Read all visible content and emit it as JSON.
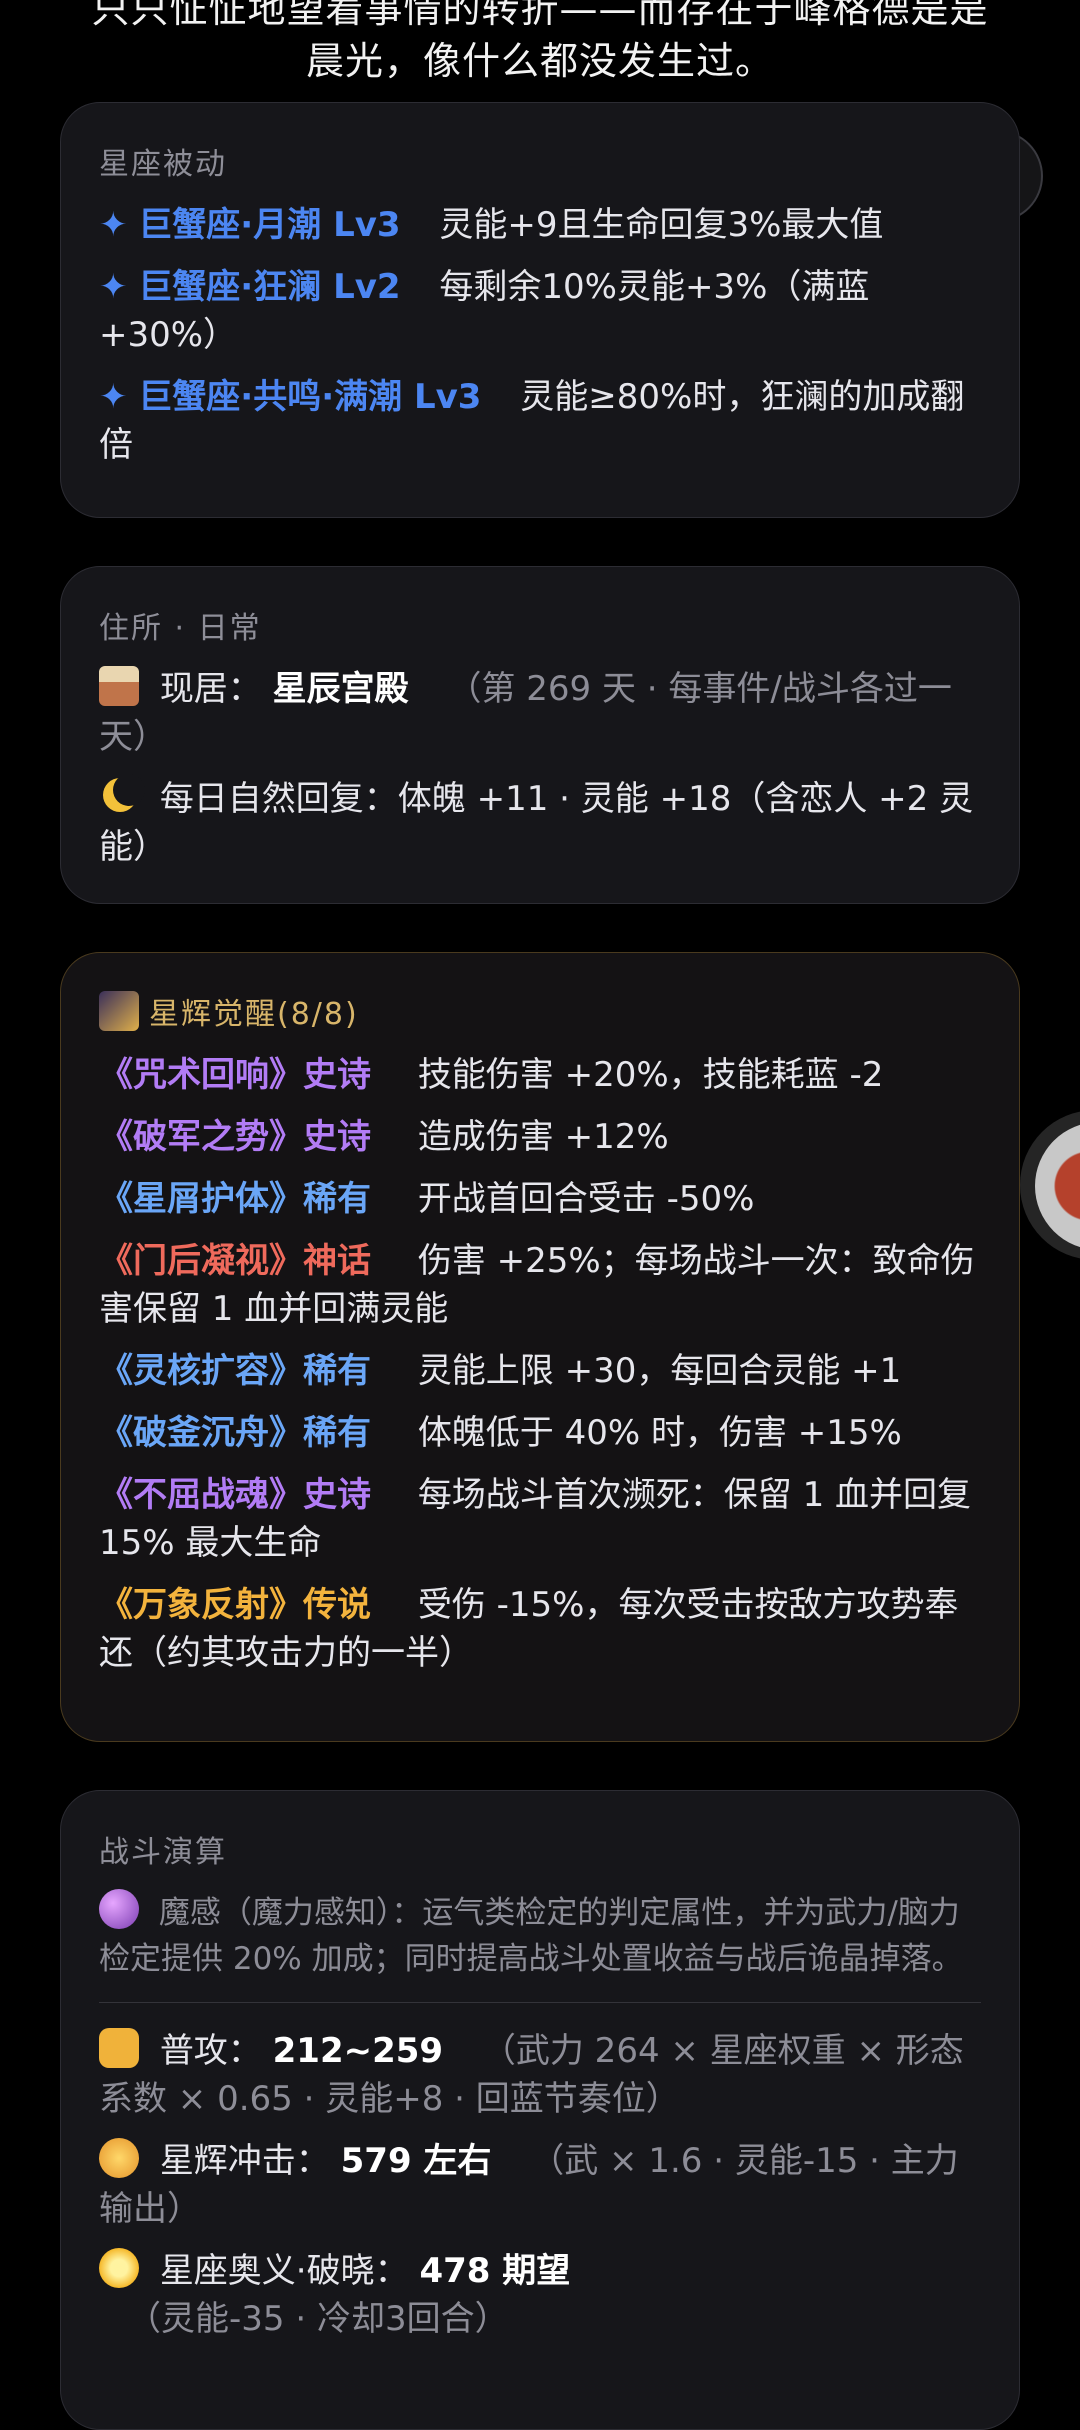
{
  "top": {
    "cut_line": "只只怔怔地望着事情的转折——而存在于峰格德是是",
    "main_line": "晨光，像什么都没发生过。"
  },
  "constellation_passive": {
    "title": "星座被动",
    "items": [
      {
        "star": "✦",
        "name": "巨蟹座·月潮 Lv3",
        "desc": "灵能+9且生命回复3%最大值"
      },
      {
        "star": "✦",
        "name": "巨蟹座·狂澜 Lv2",
        "desc": "每剩余10%灵能+3%（满蓝+30%）"
      },
      {
        "star": "✦",
        "name": "巨蟹座·共鸣·满潮 Lv3",
        "desc": "灵能≥80%时，狂澜的加成翻倍"
      }
    ]
  },
  "residence": {
    "title": "住所 · 日常",
    "current_label": "现居：",
    "current_value": "星辰宫殿",
    "current_note": "（第 269 天 · 每事件/战斗各过一天）",
    "daily": "每日自然回复：体魄 +11 · 灵能 +18（含恋人 +2 灵能）",
    "icons": [
      "house-icon",
      "moon-icon"
    ]
  },
  "awakening": {
    "title": "星辉觉醒(8/8)",
    "icon": "meteor-icon",
    "items": [
      {
        "name": "《咒术回响》史诗",
        "rarity": "epic",
        "color": "#b27cf5",
        "desc": "技能伤害 +20%，技能耗蓝 -2"
      },
      {
        "name": "《破军之势》史诗",
        "rarity": "epic",
        "color": "#b27cf5",
        "desc": "造成伤害 +12%"
      },
      {
        "name": "《星屑护体》稀有",
        "rarity": "rare",
        "color": "#6aa6f7",
        "desc": "开战首回合受击 -50%"
      },
      {
        "name": "《门后凝视》神话",
        "rarity": "mythic",
        "color": "#ef6a5c",
        "desc": "伤害 +25%；每场战斗一次：致命伤害保留 1 血并回满灵能"
      },
      {
        "name": "《灵核扩容》稀有",
        "rarity": "rare",
        "color": "#6aa6f7",
        "desc": "灵能上限 +30，每回合灵能 +1"
      },
      {
        "name": "《破釜沉舟》稀有",
        "rarity": "rare",
        "color": "#6aa6f7",
        "desc": "体魄低于 40% 时，伤害 +15%"
      },
      {
        "name": "《不屈战魂》史诗",
        "rarity": "epic",
        "color": "#b27cf5",
        "desc": "每场战斗首次濒死：保留 1 血并回复 15% 最大生命"
      },
      {
        "name": "《万象反射》传说",
        "rarity": "legendary",
        "color": "#f3b33d",
        "desc": "受伤 -15%，每次受击按敌方攻势奉还（约其攻击力的一半）"
      }
    ]
  },
  "battle": {
    "title": "战斗演算",
    "perception": "魔感（魔力感知）：运气类检定的判定属性，并为武力/脑力检定提供 20% 加成；同时提高战斗处置收益与战后诡晶掉落。",
    "attacks": [
      {
        "icon": "fist-icon",
        "label": "普攻：",
        "value": "212~259",
        "note": "（武力 264 × 星座权重 × 形态系数 × 0.65 · 灵能+8 · 回蓝节奏位）"
      },
      {
        "icon": "swirl-icon",
        "label": "星辉冲击：",
        "value": "579 左右",
        "note": "（武 × 1.6 · 灵能-15 · 主力输出）"
      },
      {
        "icon": "sun-icon",
        "label": "星座奥义·破晓：",
        "value": "478 期望",
        "note": "（灵能-35 · 冷却3回合）"
      }
    ]
  }
}
